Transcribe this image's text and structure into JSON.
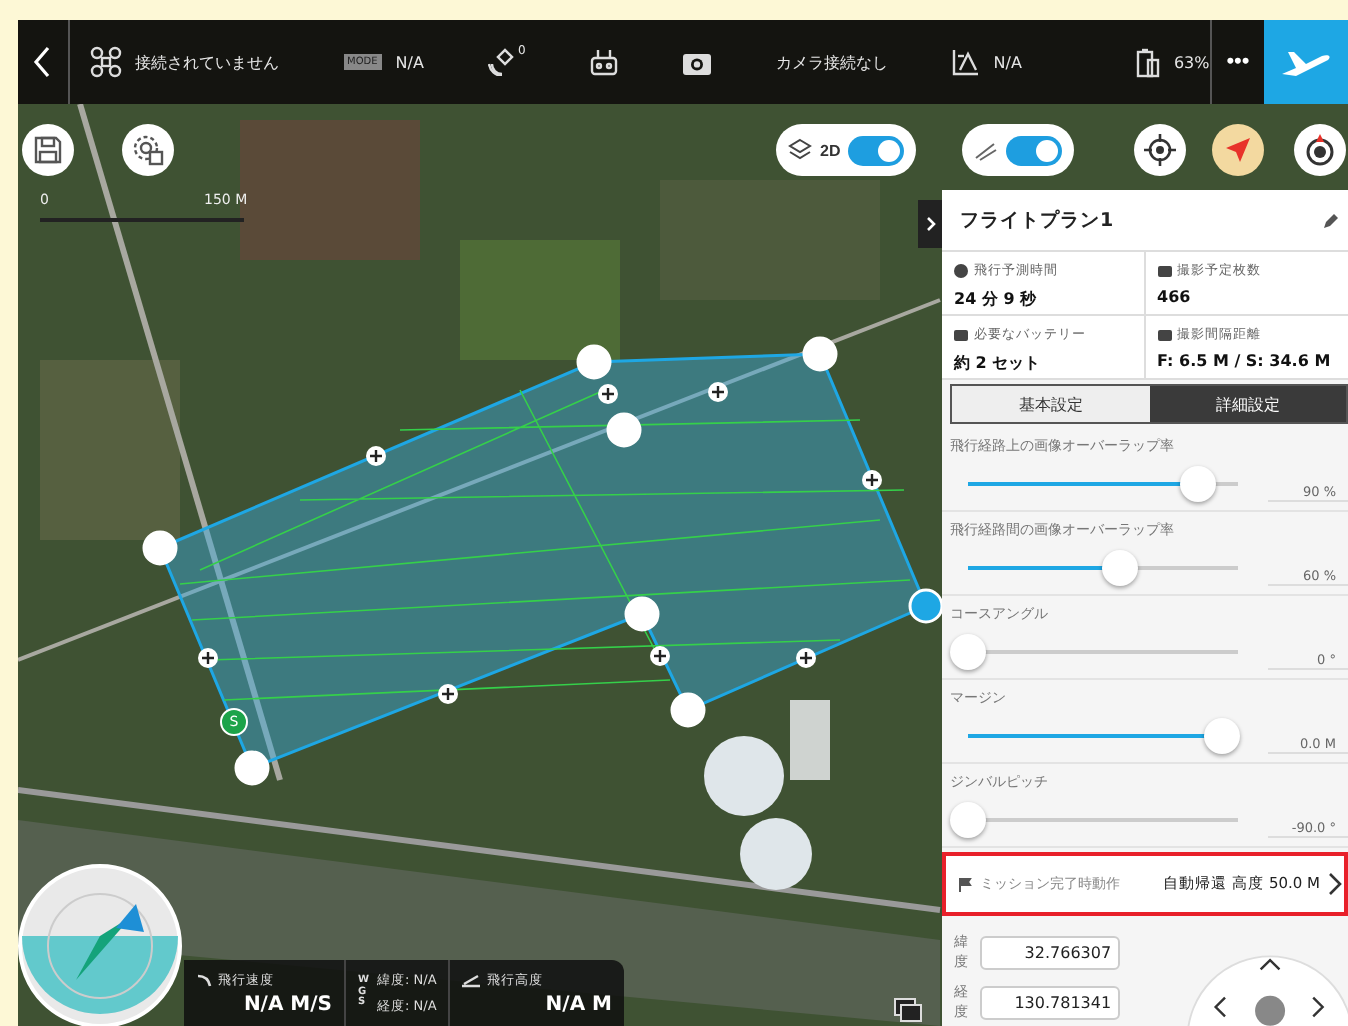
{
  "top_bar": {
    "aircraft_status": "接続されていません",
    "mode_badge": "MODE",
    "mode": "N/A",
    "satellites": "0",
    "camera_status": "カメラ接続なし",
    "altitude_limit": "N/A",
    "battery": "63%",
    "more": "•••"
  },
  "map": {
    "scale_start": "0",
    "scale_end": "150 M",
    "start_marker": "S",
    "view_toggle": {
      "label": "2D",
      "on": true
    },
    "route_toggle": {
      "on": true
    }
  },
  "panel": {
    "title": "フライトプラン1",
    "stats": [
      {
        "label": "飛行予測時間",
        "value": "24 分 9 秒"
      },
      {
        "label": "撮影予定枚数",
        "value": "466"
      },
      {
        "label": "必要なバッテリー",
        "value": "約 2 セット"
      },
      {
        "label": "撮影間隔距離",
        "value": "F: 6.5 M / S: 34.6 M"
      }
    ],
    "tabs": [
      {
        "label": "基本設定",
        "selected": false
      },
      {
        "label": "詳細設定",
        "selected": true
      }
    ],
    "sliders": [
      {
        "label": "飛行経路上の画像オーバーラップ率",
        "level": 0.85,
        "reading": "90 %"
      },
      {
        "label": "飛行経路間の画像オーバーラップ率",
        "level": 0.56,
        "reading": "60 %"
      },
      {
        "label": "コースアングル",
        "level": 0,
        "reading": "0 °"
      },
      {
        "label": "マージン",
        "level": 0.94,
        "reading": "0.0 M"
      },
      {
        "label": "ジンバルピッチ",
        "level": 0,
        "reading": "-90.0 °"
      }
    ],
    "mission_action": {
      "label": "ミッション完了時動作",
      "value": "自動帰還 高度 50.0 M"
    },
    "coordinates": [
      {
        "label": "緯度",
        "value": "32.766307"
      },
      {
        "label": "経度",
        "value": "130.781341"
      }
    ]
  },
  "telemetry": {
    "speed_label": "飛行速度",
    "speed": "N/A M/S",
    "wgs": [
      "W",
      "G",
      "S"
    ],
    "latitude": "緯度: N/A",
    "longitude": "経度: N/A",
    "altitude_label": "飛行高度",
    "altitude": "N/A M"
  }
}
